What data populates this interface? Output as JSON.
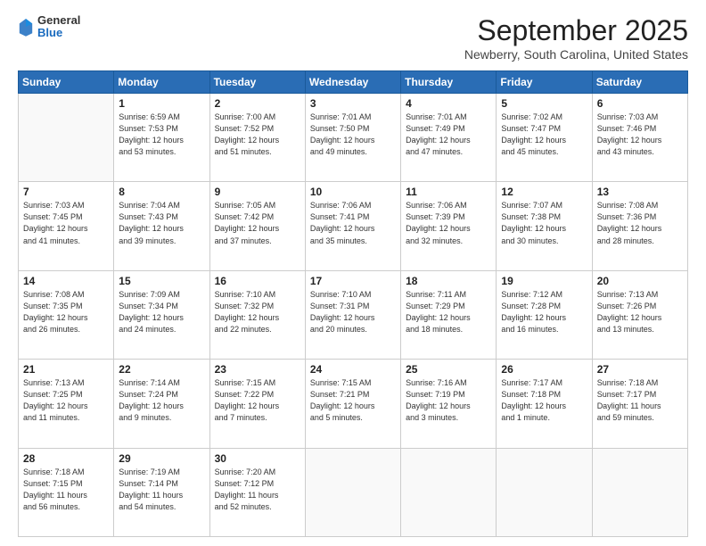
{
  "header": {
    "logo": {
      "line1": "General",
      "line2": "Blue"
    },
    "title": "September 2025",
    "location": "Newberry, South Carolina, United States"
  },
  "days_of_week": [
    "Sunday",
    "Monday",
    "Tuesday",
    "Wednesday",
    "Thursday",
    "Friday",
    "Saturday"
  ],
  "weeks": [
    [
      {
        "day": "",
        "info": ""
      },
      {
        "day": "1",
        "info": "Sunrise: 6:59 AM\nSunset: 7:53 PM\nDaylight: 12 hours\nand 53 minutes."
      },
      {
        "day": "2",
        "info": "Sunrise: 7:00 AM\nSunset: 7:52 PM\nDaylight: 12 hours\nand 51 minutes."
      },
      {
        "day": "3",
        "info": "Sunrise: 7:01 AM\nSunset: 7:50 PM\nDaylight: 12 hours\nand 49 minutes."
      },
      {
        "day": "4",
        "info": "Sunrise: 7:01 AM\nSunset: 7:49 PM\nDaylight: 12 hours\nand 47 minutes."
      },
      {
        "day": "5",
        "info": "Sunrise: 7:02 AM\nSunset: 7:47 PM\nDaylight: 12 hours\nand 45 minutes."
      },
      {
        "day": "6",
        "info": "Sunrise: 7:03 AM\nSunset: 7:46 PM\nDaylight: 12 hours\nand 43 minutes."
      }
    ],
    [
      {
        "day": "7",
        "info": "Sunrise: 7:03 AM\nSunset: 7:45 PM\nDaylight: 12 hours\nand 41 minutes."
      },
      {
        "day": "8",
        "info": "Sunrise: 7:04 AM\nSunset: 7:43 PM\nDaylight: 12 hours\nand 39 minutes."
      },
      {
        "day": "9",
        "info": "Sunrise: 7:05 AM\nSunset: 7:42 PM\nDaylight: 12 hours\nand 37 minutes."
      },
      {
        "day": "10",
        "info": "Sunrise: 7:06 AM\nSunset: 7:41 PM\nDaylight: 12 hours\nand 35 minutes."
      },
      {
        "day": "11",
        "info": "Sunrise: 7:06 AM\nSunset: 7:39 PM\nDaylight: 12 hours\nand 32 minutes."
      },
      {
        "day": "12",
        "info": "Sunrise: 7:07 AM\nSunset: 7:38 PM\nDaylight: 12 hours\nand 30 minutes."
      },
      {
        "day": "13",
        "info": "Sunrise: 7:08 AM\nSunset: 7:36 PM\nDaylight: 12 hours\nand 28 minutes."
      }
    ],
    [
      {
        "day": "14",
        "info": "Sunrise: 7:08 AM\nSunset: 7:35 PM\nDaylight: 12 hours\nand 26 minutes."
      },
      {
        "day": "15",
        "info": "Sunrise: 7:09 AM\nSunset: 7:34 PM\nDaylight: 12 hours\nand 24 minutes."
      },
      {
        "day": "16",
        "info": "Sunrise: 7:10 AM\nSunset: 7:32 PM\nDaylight: 12 hours\nand 22 minutes."
      },
      {
        "day": "17",
        "info": "Sunrise: 7:10 AM\nSunset: 7:31 PM\nDaylight: 12 hours\nand 20 minutes."
      },
      {
        "day": "18",
        "info": "Sunrise: 7:11 AM\nSunset: 7:29 PM\nDaylight: 12 hours\nand 18 minutes."
      },
      {
        "day": "19",
        "info": "Sunrise: 7:12 AM\nSunset: 7:28 PM\nDaylight: 12 hours\nand 16 minutes."
      },
      {
        "day": "20",
        "info": "Sunrise: 7:13 AM\nSunset: 7:26 PM\nDaylight: 12 hours\nand 13 minutes."
      }
    ],
    [
      {
        "day": "21",
        "info": "Sunrise: 7:13 AM\nSunset: 7:25 PM\nDaylight: 12 hours\nand 11 minutes."
      },
      {
        "day": "22",
        "info": "Sunrise: 7:14 AM\nSunset: 7:24 PM\nDaylight: 12 hours\nand 9 minutes."
      },
      {
        "day": "23",
        "info": "Sunrise: 7:15 AM\nSunset: 7:22 PM\nDaylight: 12 hours\nand 7 minutes."
      },
      {
        "day": "24",
        "info": "Sunrise: 7:15 AM\nSunset: 7:21 PM\nDaylight: 12 hours\nand 5 minutes."
      },
      {
        "day": "25",
        "info": "Sunrise: 7:16 AM\nSunset: 7:19 PM\nDaylight: 12 hours\nand 3 minutes."
      },
      {
        "day": "26",
        "info": "Sunrise: 7:17 AM\nSunset: 7:18 PM\nDaylight: 12 hours\nand 1 minute."
      },
      {
        "day": "27",
        "info": "Sunrise: 7:18 AM\nSunset: 7:17 PM\nDaylight: 11 hours\nand 59 minutes."
      }
    ],
    [
      {
        "day": "28",
        "info": "Sunrise: 7:18 AM\nSunset: 7:15 PM\nDaylight: 11 hours\nand 56 minutes."
      },
      {
        "day": "29",
        "info": "Sunrise: 7:19 AM\nSunset: 7:14 PM\nDaylight: 11 hours\nand 54 minutes."
      },
      {
        "day": "30",
        "info": "Sunrise: 7:20 AM\nSunset: 7:12 PM\nDaylight: 11 hours\nand 52 minutes."
      },
      {
        "day": "",
        "info": ""
      },
      {
        "day": "",
        "info": ""
      },
      {
        "day": "",
        "info": ""
      },
      {
        "day": "",
        "info": ""
      }
    ]
  ]
}
